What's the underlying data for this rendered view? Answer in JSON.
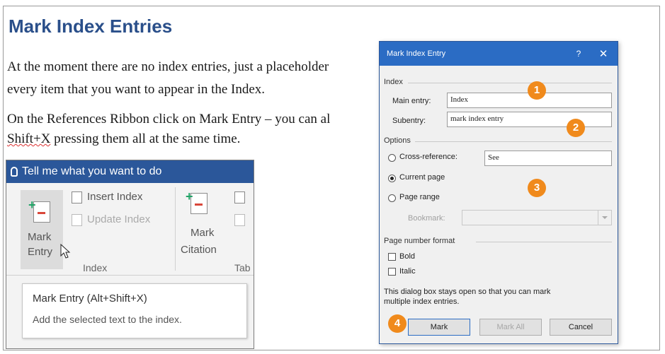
{
  "document": {
    "title": "Mark Index Entries",
    "para1_line1": "At the moment there are no index entries, just a placeholder",
    "para1_line2": "every item that you want to appear in the Index.",
    "para2_line1": "On the References Ribbon click on Mark Entry – you can al",
    "para2_line2_underlined": "Shift+X",
    "para2_line2_rest": " pressing them all at the same time."
  },
  "ribbon": {
    "tell_me": "Tell me what you want to do",
    "mark_entry_line1": "Mark",
    "mark_entry_line2": "Entry",
    "insert_index": "Insert Index",
    "update_index": "Update Index",
    "mark_citation_line1": "Mark",
    "mark_citation_line2": "Citation",
    "group_index": "Index",
    "group_table_partial": "Tab",
    "tooltip_title": "Mark Entry (Alt+Shift+X)",
    "tooltip_desc": "Add the selected text to the index."
  },
  "dialog": {
    "title": "Mark Index Entry",
    "help": "?",
    "close": "✕",
    "section_index": "Index",
    "main_entry_label": "Main entry:",
    "main_entry_value": "Index",
    "subentry_label": "Subentry:",
    "subentry_value": "mark index entry",
    "section_options": "Options",
    "cross_reference_label": "Cross-reference:",
    "cross_reference_value": "See",
    "current_page_label": "Current page",
    "page_range_label": "Page range",
    "bookmark_label": "Bookmark:",
    "section_page_number_format": "Page number format",
    "bold_label": "Bold",
    "italic_label": "Italic",
    "info_line1": "This dialog box stays open so that you can mark",
    "info_line2": "multiple index entries.",
    "mark_button": "Mark",
    "mark_all_button": "Mark All",
    "cancel_button": "Cancel",
    "selected_option": "current_page"
  },
  "callouts": [
    "1",
    "2",
    "3",
    "4"
  ],
  "colors": {
    "title_blue": "#2a4f8a",
    "ribbon_blue": "#2b579a",
    "dialog_title_blue": "#2b6cc4",
    "callout_orange": "#f08a1c"
  }
}
